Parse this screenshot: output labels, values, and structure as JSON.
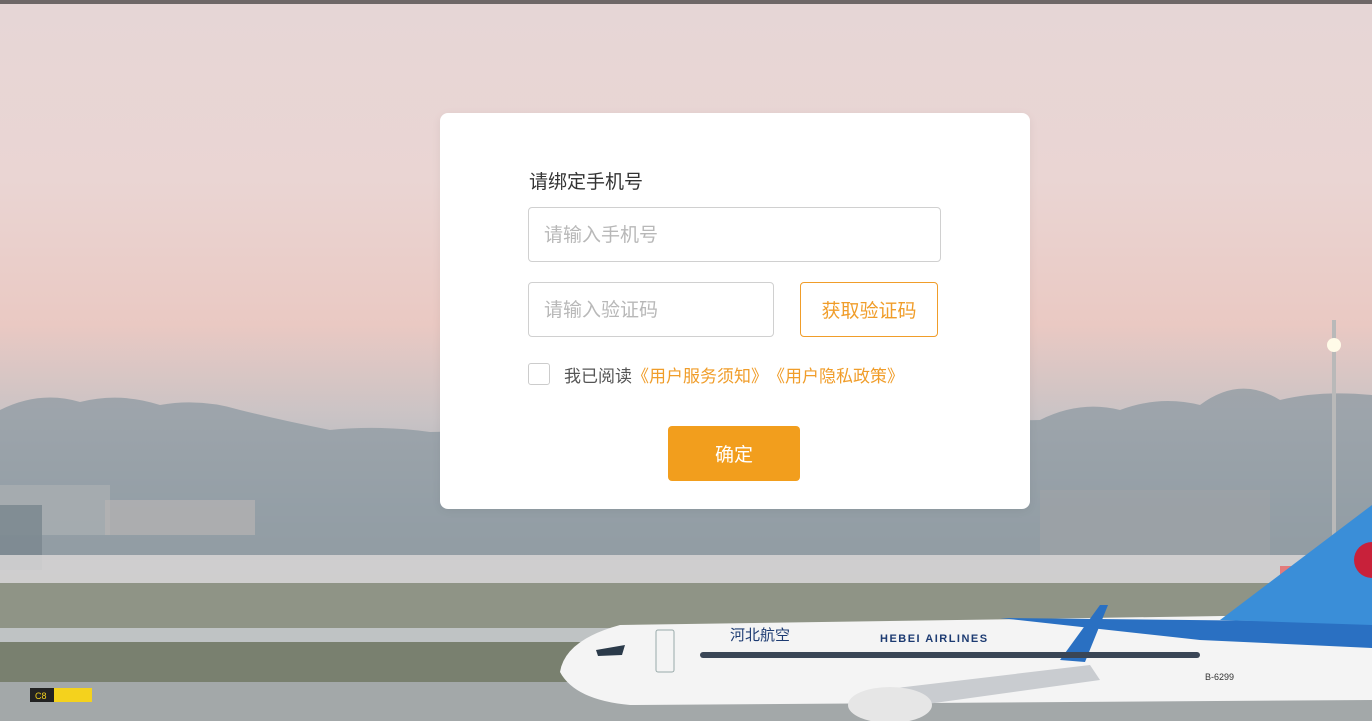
{
  "form": {
    "title": "请绑定手机号",
    "phone_placeholder": "请输入手机号",
    "code_placeholder": "请输入验证码",
    "get_code_label": "获取验证码",
    "agree_prefix": "我已阅读",
    "service_terms_link": "《用户服务须知》",
    "privacy_policy_link": "《用户隐私政策》",
    "confirm_label": "确定"
  },
  "background": {
    "airline_name": "HEBEI AIRLINES",
    "airline_name_cn": "河北航空",
    "aircraft_registration": "B-6299",
    "taxiway_sign": "C8"
  },
  "colors": {
    "accent": "#f29e1d",
    "link": "#f09d2a",
    "card": "#ffffff"
  }
}
